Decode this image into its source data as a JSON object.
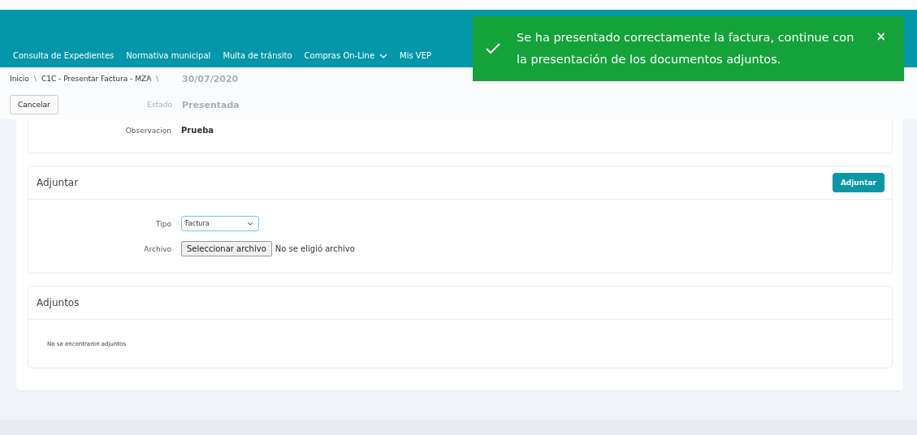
{
  "nav": {
    "items": [
      {
        "label": "Consulta de Expedientes",
        "has_menu": false
      },
      {
        "label": "Normativa municipal",
        "has_menu": false
      },
      {
        "label": "Multa de tránsito",
        "has_menu": false
      },
      {
        "label": "Compras On-Line",
        "has_menu": true
      },
      {
        "label": "Mis VEP",
        "has_menu": false
      }
    ]
  },
  "breadcrumb": [
    "Inicio",
    "C1C - Presentar Factura - MZA"
  ],
  "breadcrumb_separator": "\\",
  "faded_fields": {
    "date": "30/07/2020",
    "status_label": "Estado",
    "status_value": "Presentada"
  },
  "cancel_button": "Cancelar",
  "observation": {
    "label": "Observacion",
    "value": "Prueba"
  },
  "attach_card": {
    "title": "Adjuntar",
    "button": "Adjuntar",
    "type_label": "Tipo",
    "type_value": "Factura",
    "file_label": "Archivo",
    "file_button": "Seleccionar archivo",
    "file_status": "No se eligió archivo"
  },
  "attachments_card": {
    "title": "Adjuntos",
    "empty": "No se encontraron adjuntos"
  },
  "toast": {
    "message": "Se ha presentado correctamente la factura, continue con la presentación de los documentos adjuntos.",
    "close": "×"
  }
}
